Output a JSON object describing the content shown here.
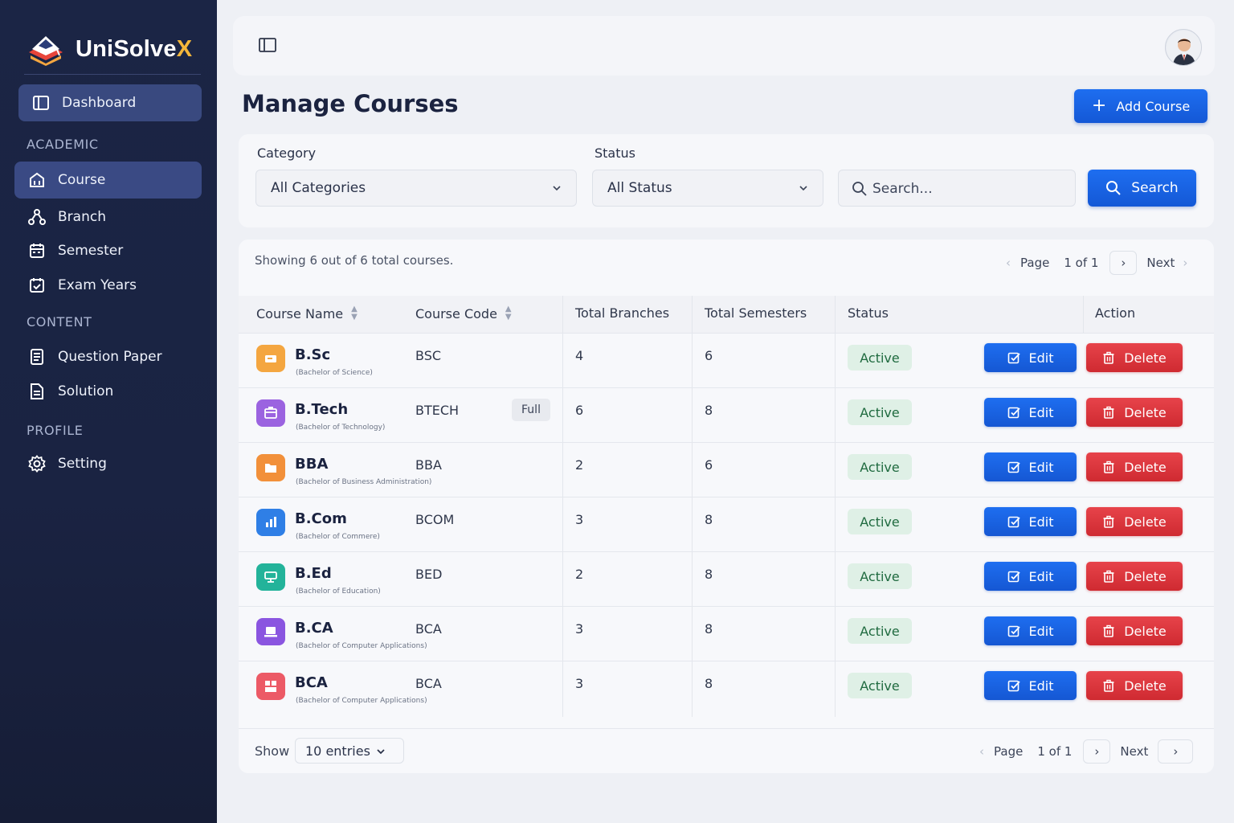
{
  "app": {
    "name_main": "UniSolve",
    "name_accent": "X"
  },
  "sidebar": {
    "dashboard": "Dashboard",
    "sections": {
      "academic": "ACADEMIC",
      "content": "CONTENT",
      "profile": "PROFILE"
    },
    "items": [
      {
        "label": "Course",
        "icon": "building-icon",
        "active": true
      },
      {
        "label": "Branch",
        "icon": "branch-icon",
        "active": false
      },
      {
        "label": "Semester",
        "icon": "calendar-icon",
        "active": false
      },
      {
        "label": "Exam Years",
        "icon": "calendar-check-icon",
        "active": false
      },
      {
        "label": "Question Paper",
        "icon": "document-icon",
        "active": false
      },
      {
        "label": "Solution",
        "icon": "file-text-icon",
        "active": false
      },
      {
        "label": "Setting",
        "icon": "gear-icon",
        "active": false
      }
    ]
  },
  "page": {
    "title": "Manage Courses",
    "add_button": "Add Course"
  },
  "filters": {
    "category_label": "Category",
    "category_value": "All Categories",
    "status_label": "Status",
    "status_value": "All Status",
    "search_placeholder": "Search...",
    "search_button": "Search"
  },
  "table": {
    "summary": "Showing 6 out of 6 total courses.",
    "pager": {
      "page_label": "Page",
      "page_value": "1 of 1",
      "next": "Next"
    },
    "headers": {
      "name": "Course Name",
      "code": "Course Code",
      "branches": "Total Branches",
      "semesters": "Total Semesters",
      "status": "Status",
      "action": "Action"
    },
    "edit_label": "Edit",
    "delete_label": "Delete",
    "rows": [
      {
        "name": "B.Sc",
        "full": "(Bachelor of Science)",
        "code": "BSC",
        "tag": "",
        "branches": "4",
        "semesters": "6",
        "status": "Active",
        "icon_color": "#f4a640"
      },
      {
        "name": "B.Tech",
        "full": "(Bachelor of Technology)",
        "code": "BTECH",
        "tag": "Full",
        "branches": "6",
        "semesters": "8",
        "status": "Active",
        "icon_color": "#9b63e0"
      },
      {
        "name": "BBA",
        "full": "(Bachelor of Business Administration)",
        "code": "BBA",
        "tag": "",
        "branches": "2",
        "semesters": "6",
        "status": "Active",
        "icon_color": "#f2903a"
      },
      {
        "name": "B.Com",
        "full": "(Bachelor of Commere)",
        "code": "BCOM",
        "tag": "",
        "branches": "3",
        "semesters": "8",
        "status": "Active",
        "icon_color": "#2f7fe6"
      },
      {
        "name": "B.Ed",
        "full": "(Bachelor of Education)",
        "code": "BED",
        "tag": "",
        "branches": "2",
        "semesters": "8",
        "status": "Active",
        "icon_color": "#23b39a"
      },
      {
        "name": "B.CA",
        "full": "(Bachelor of Computer Applications)",
        "code": "BCA",
        "tag": "",
        "branches": "3",
        "semesters": "8",
        "status": "Active",
        "icon_color": "#8a55e0"
      },
      {
        "name": "BCA",
        "full": "(Bachelor of Computer Applications)",
        "code": "BCA",
        "tag": "",
        "branches": "3",
        "semesters": "8",
        "status": "Active",
        "icon_color": "#ec5a66"
      }
    ],
    "footer": {
      "show_label": "Show",
      "entries_value": "10 entries"
    }
  },
  "colors": {
    "sidebar_bg": "#1b2545",
    "primary": "#1e6ef0",
    "danger": "#e7434a",
    "status_bg": "#dff0e6"
  }
}
